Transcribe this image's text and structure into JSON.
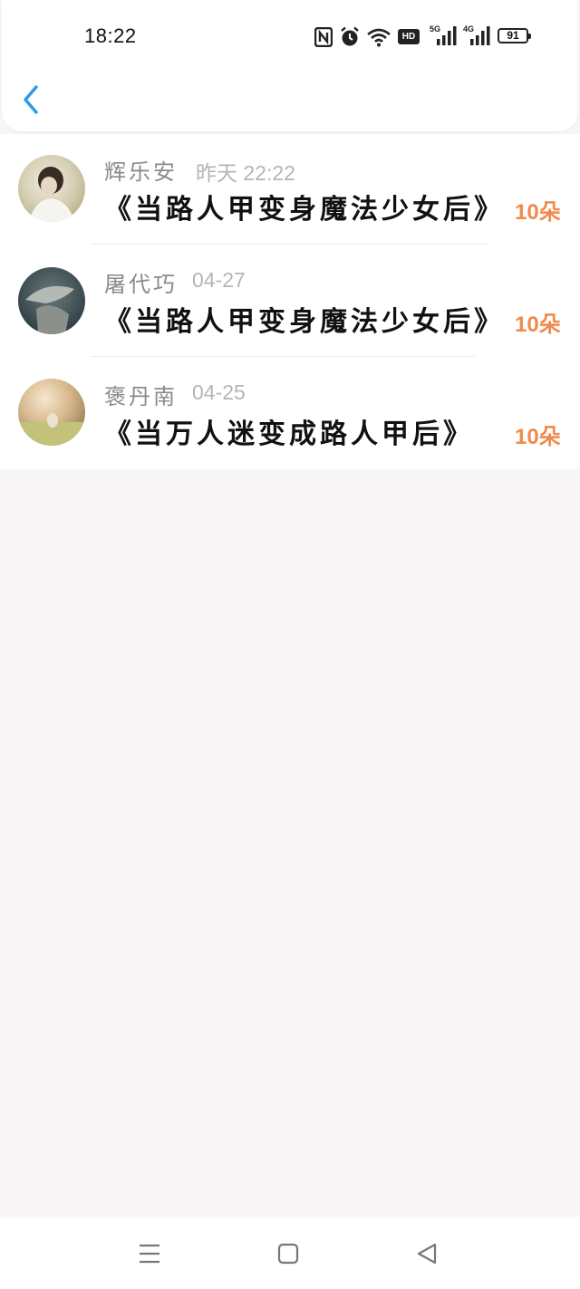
{
  "status_bar": {
    "time": "18:22",
    "icons": [
      "nfc-icon",
      "alarm-icon",
      "wifi-icon",
      "hd-icon",
      "signal-5g-icon",
      "signal-4g-icon"
    ],
    "signal_5g_label": "5G",
    "signal_4g_label": "4G",
    "hd_label": "HD",
    "battery": "91"
  },
  "header": {
    "back_icon": "chevron-left-icon",
    "accent_color": "#2b9be8"
  },
  "gifts": [
    {
      "name": "辉乐安",
      "date": "昨天 22:22",
      "book": "《当路人甲变身魔法少女后》",
      "count": "10朵"
    },
    {
      "name": "屠代巧",
      "date": "04-27",
      "book": "《当路人甲变身魔法少女后》",
      "count": "10朵"
    },
    {
      "name": "褒丹南",
      "date": "04-25",
      "book": "《当万人迷变成路人甲后》",
      "count": "10朵"
    }
  ],
  "colors": {
    "count": "#ef8a4a",
    "name": "#8a8a8a",
    "date": "#b5b5b5"
  },
  "nav_bar": {
    "icons": [
      "menu-icon",
      "home-icon",
      "back-triangle-icon"
    ]
  }
}
